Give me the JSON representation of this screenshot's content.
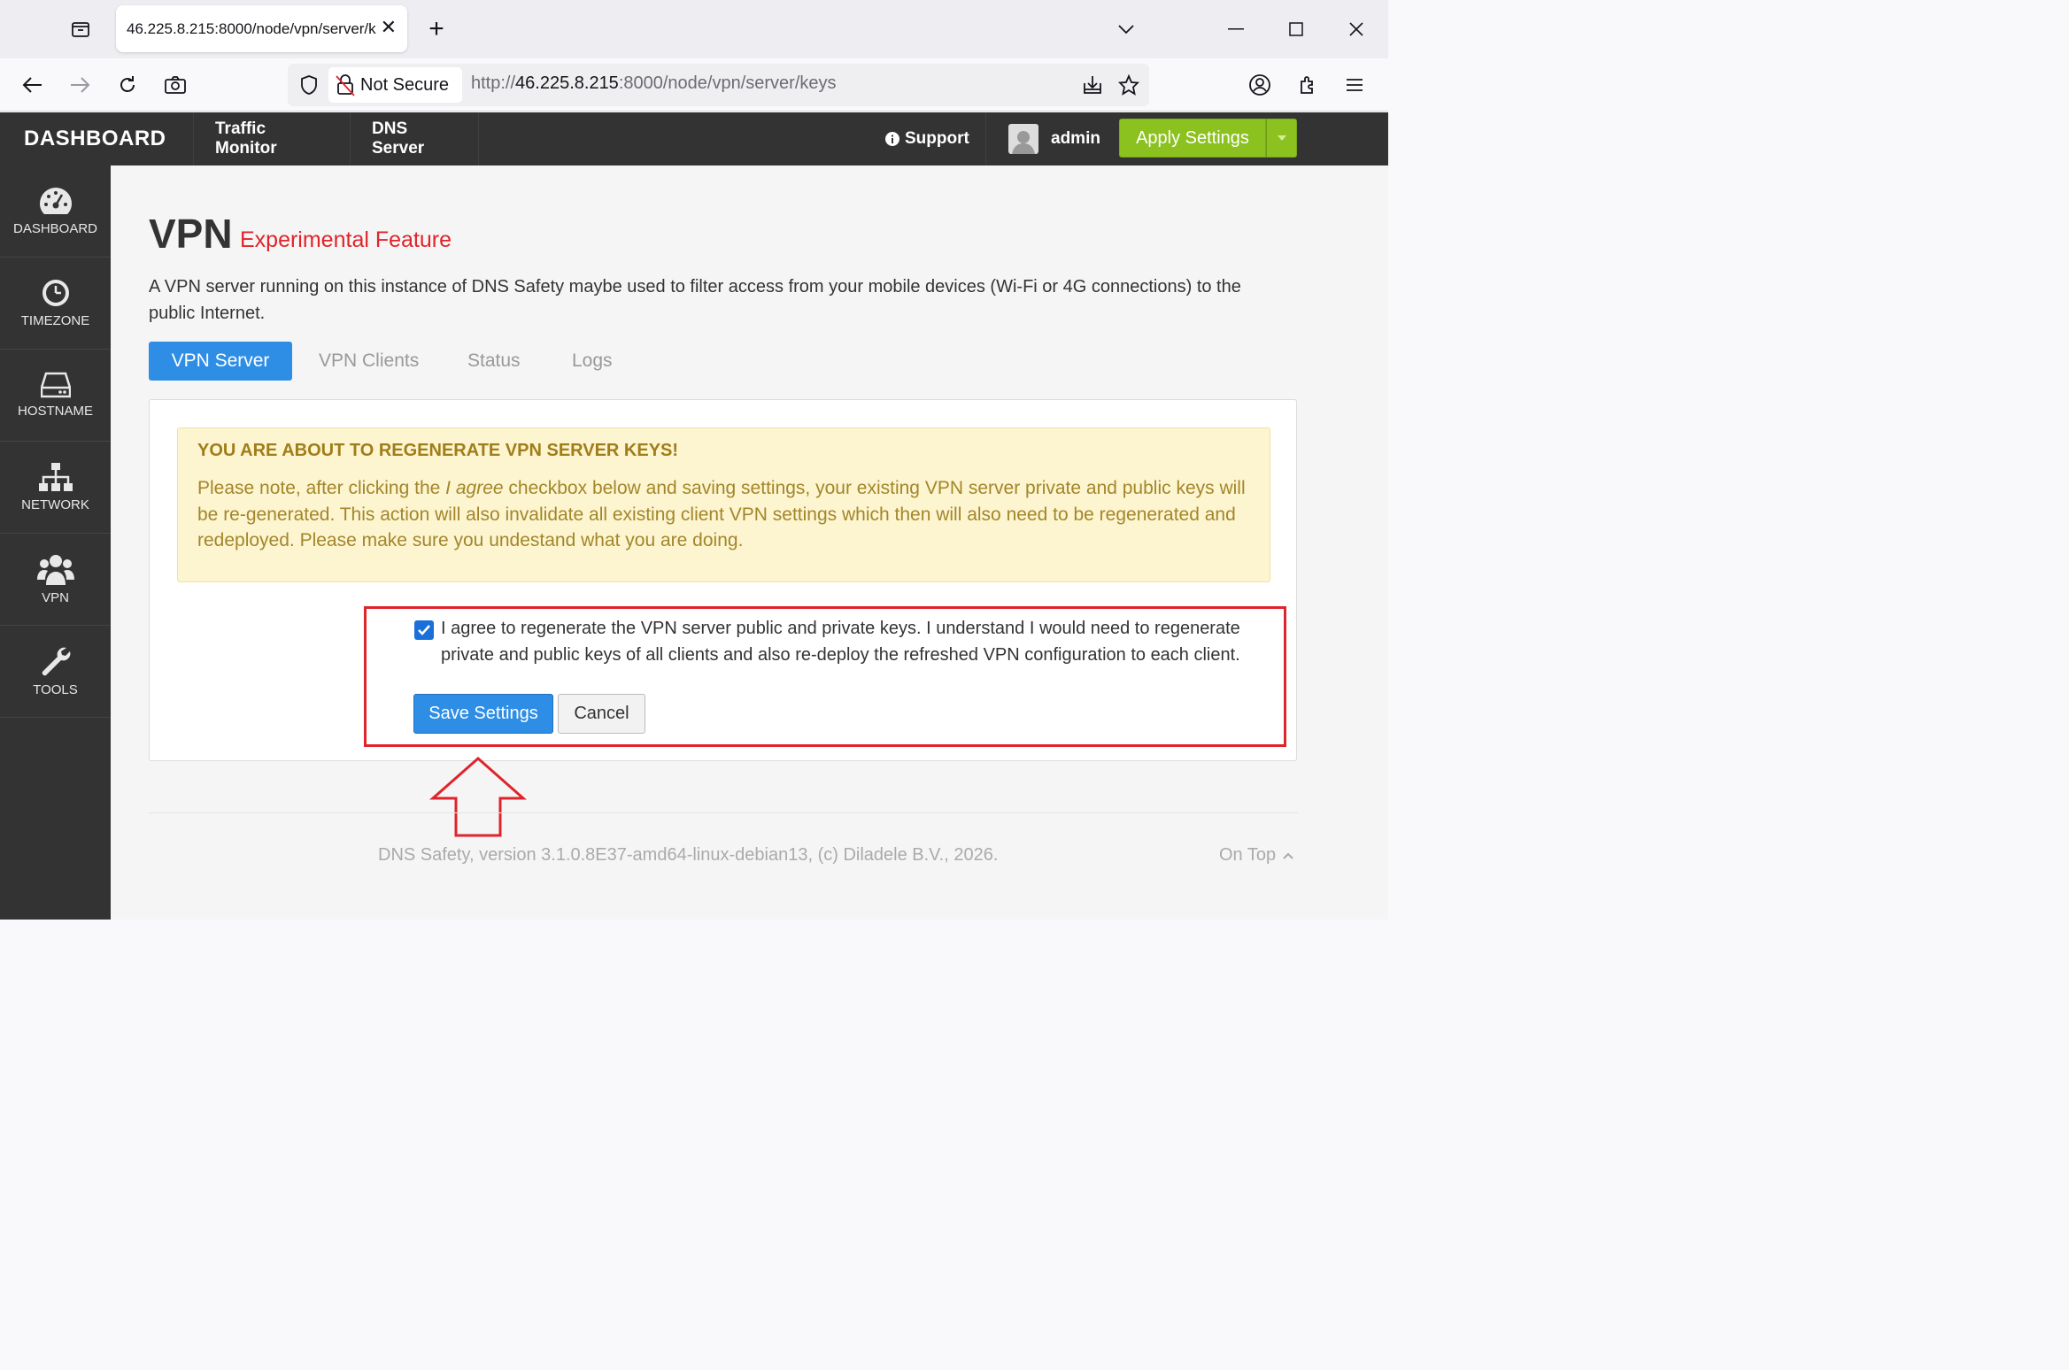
{
  "browser": {
    "tab_title": "46.225.8.215:8000/node/vpn/server/keys",
    "security_label": "Not Secure",
    "url_prefix": "http://",
    "url_host": "46.225.8.215",
    "url_path": ":8000/node/vpn/server/keys"
  },
  "header": {
    "brand": "DASHBOARD",
    "nav": [
      "Traffic Monitor",
      "DNS Server"
    ],
    "support": "Support",
    "user": "admin",
    "apply": "Apply Settings"
  },
  "sidebar": {
    "items": [
      {
        "label": "DASHBOARD",
        "icon": "gauge-icon"
      },
      {
        "label": "TIMEZONE",
        "icon": "clock-icon"
      },
      {
        "label": "HOSTNAME",
        "icon": "hard-drive-icon"
      },
      {
        "label": "NETWORK",
        "icon": "network-icon"
      },
      {
        "label": "VPN",
        "icon": "users-icon"
      },
      {
        "label": "TOOLS",
        "icon": "wrench-icon"
      }
    ]
  },
  "page": {
    "title": "VPN",
    "badge": "Experimental Feature",
    "description": "A VPN server running on this instance of DNS Safety maybe used to filter access from your mobile devices (Wi-Fi or 4G connections) to the public Internet.",
    "tabs": [
      "VPN Server",
      "VPN Clients",
      "Status",
      "Logs"
    ],
    "active_tab": "VPN Server"
  },
  "warning": {
    "title": "YOU ARE ABOUT TO REGENERATE VPN SERVER KEYS!",
    "text_before": "Please note, after clicking the ",
    "text_italic": "I agree",
    "text_after": " checkbox below and saving settings, your existing VPN server private and public keys will be re-generated. This action will also invalidate all existing client VPN settings which then will also need to be regenerated and redeployed. Please make sure you undestand what you are doing."
  },
  "form": {
    "agree_checked": true,
    "agree_label": "I agree to regenerate the VPN server public and private keys. I understand I would need to regenerate private and public keys of all clients and also re-deploy the refreshed VPN configuration to each client.",
    "save_label": "Save Settings",
    "cancel_label": "Cancel"
  },
  "footer": {
    "text": "DNS Safety, version 3.1.0.8E37-amd64-linux-debian13, (c) Diladele B.V., 2026.",
    "ontop": "On Top"
  },
  "colors": {
    "accent_blue": "#2e8ee6",
    "apply_green": "#8cc21f",
    "warning_bg": "#fcf5d0",
    "highlight_red": "#e0242b",
    "dark_bar": "#333333"
  }
}
